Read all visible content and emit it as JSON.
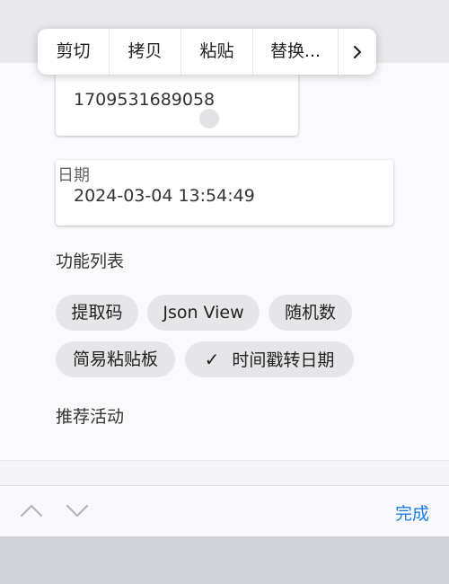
{
  "context_menu": {
    "items": [
      "剪切",
      "拷贝",
      "粘贴",
      "替换..."
    ],
    "more_icon": "chevron-right-icon"
  },
  "timestamp_field": {
    "value": "1709531689058"
  },
  "date_field": {
    "label": "日期",
    "value": "2024-03-04 13:54:49"
  },
  "features": {
    "title": "功能列表",
    "chips": [
      {
        "label": "提取码",
        "selected": false
      },
      {
        "label": "Json View",
        "selected": false
      },
      {
        "label": "随机数",
        "selected": false
      },
      {
        "label": "简易粘贴板",
        "selected": false
      },
      {
        "label": "时间戳转日期",
        "selected": true
      }
    ]
  },
  "recommend": {
    "title": "推荐活动"
  },
  "toolbar": {
    "prev_icon": "chevron-up-icon",
    "next_icon": "chevron-down-icon",
    "done_label": "完成"
  },
  "colors": {
    "accent": "#1a7ee6",
    "chip_bg": "#e6e6e9"
  }
}
